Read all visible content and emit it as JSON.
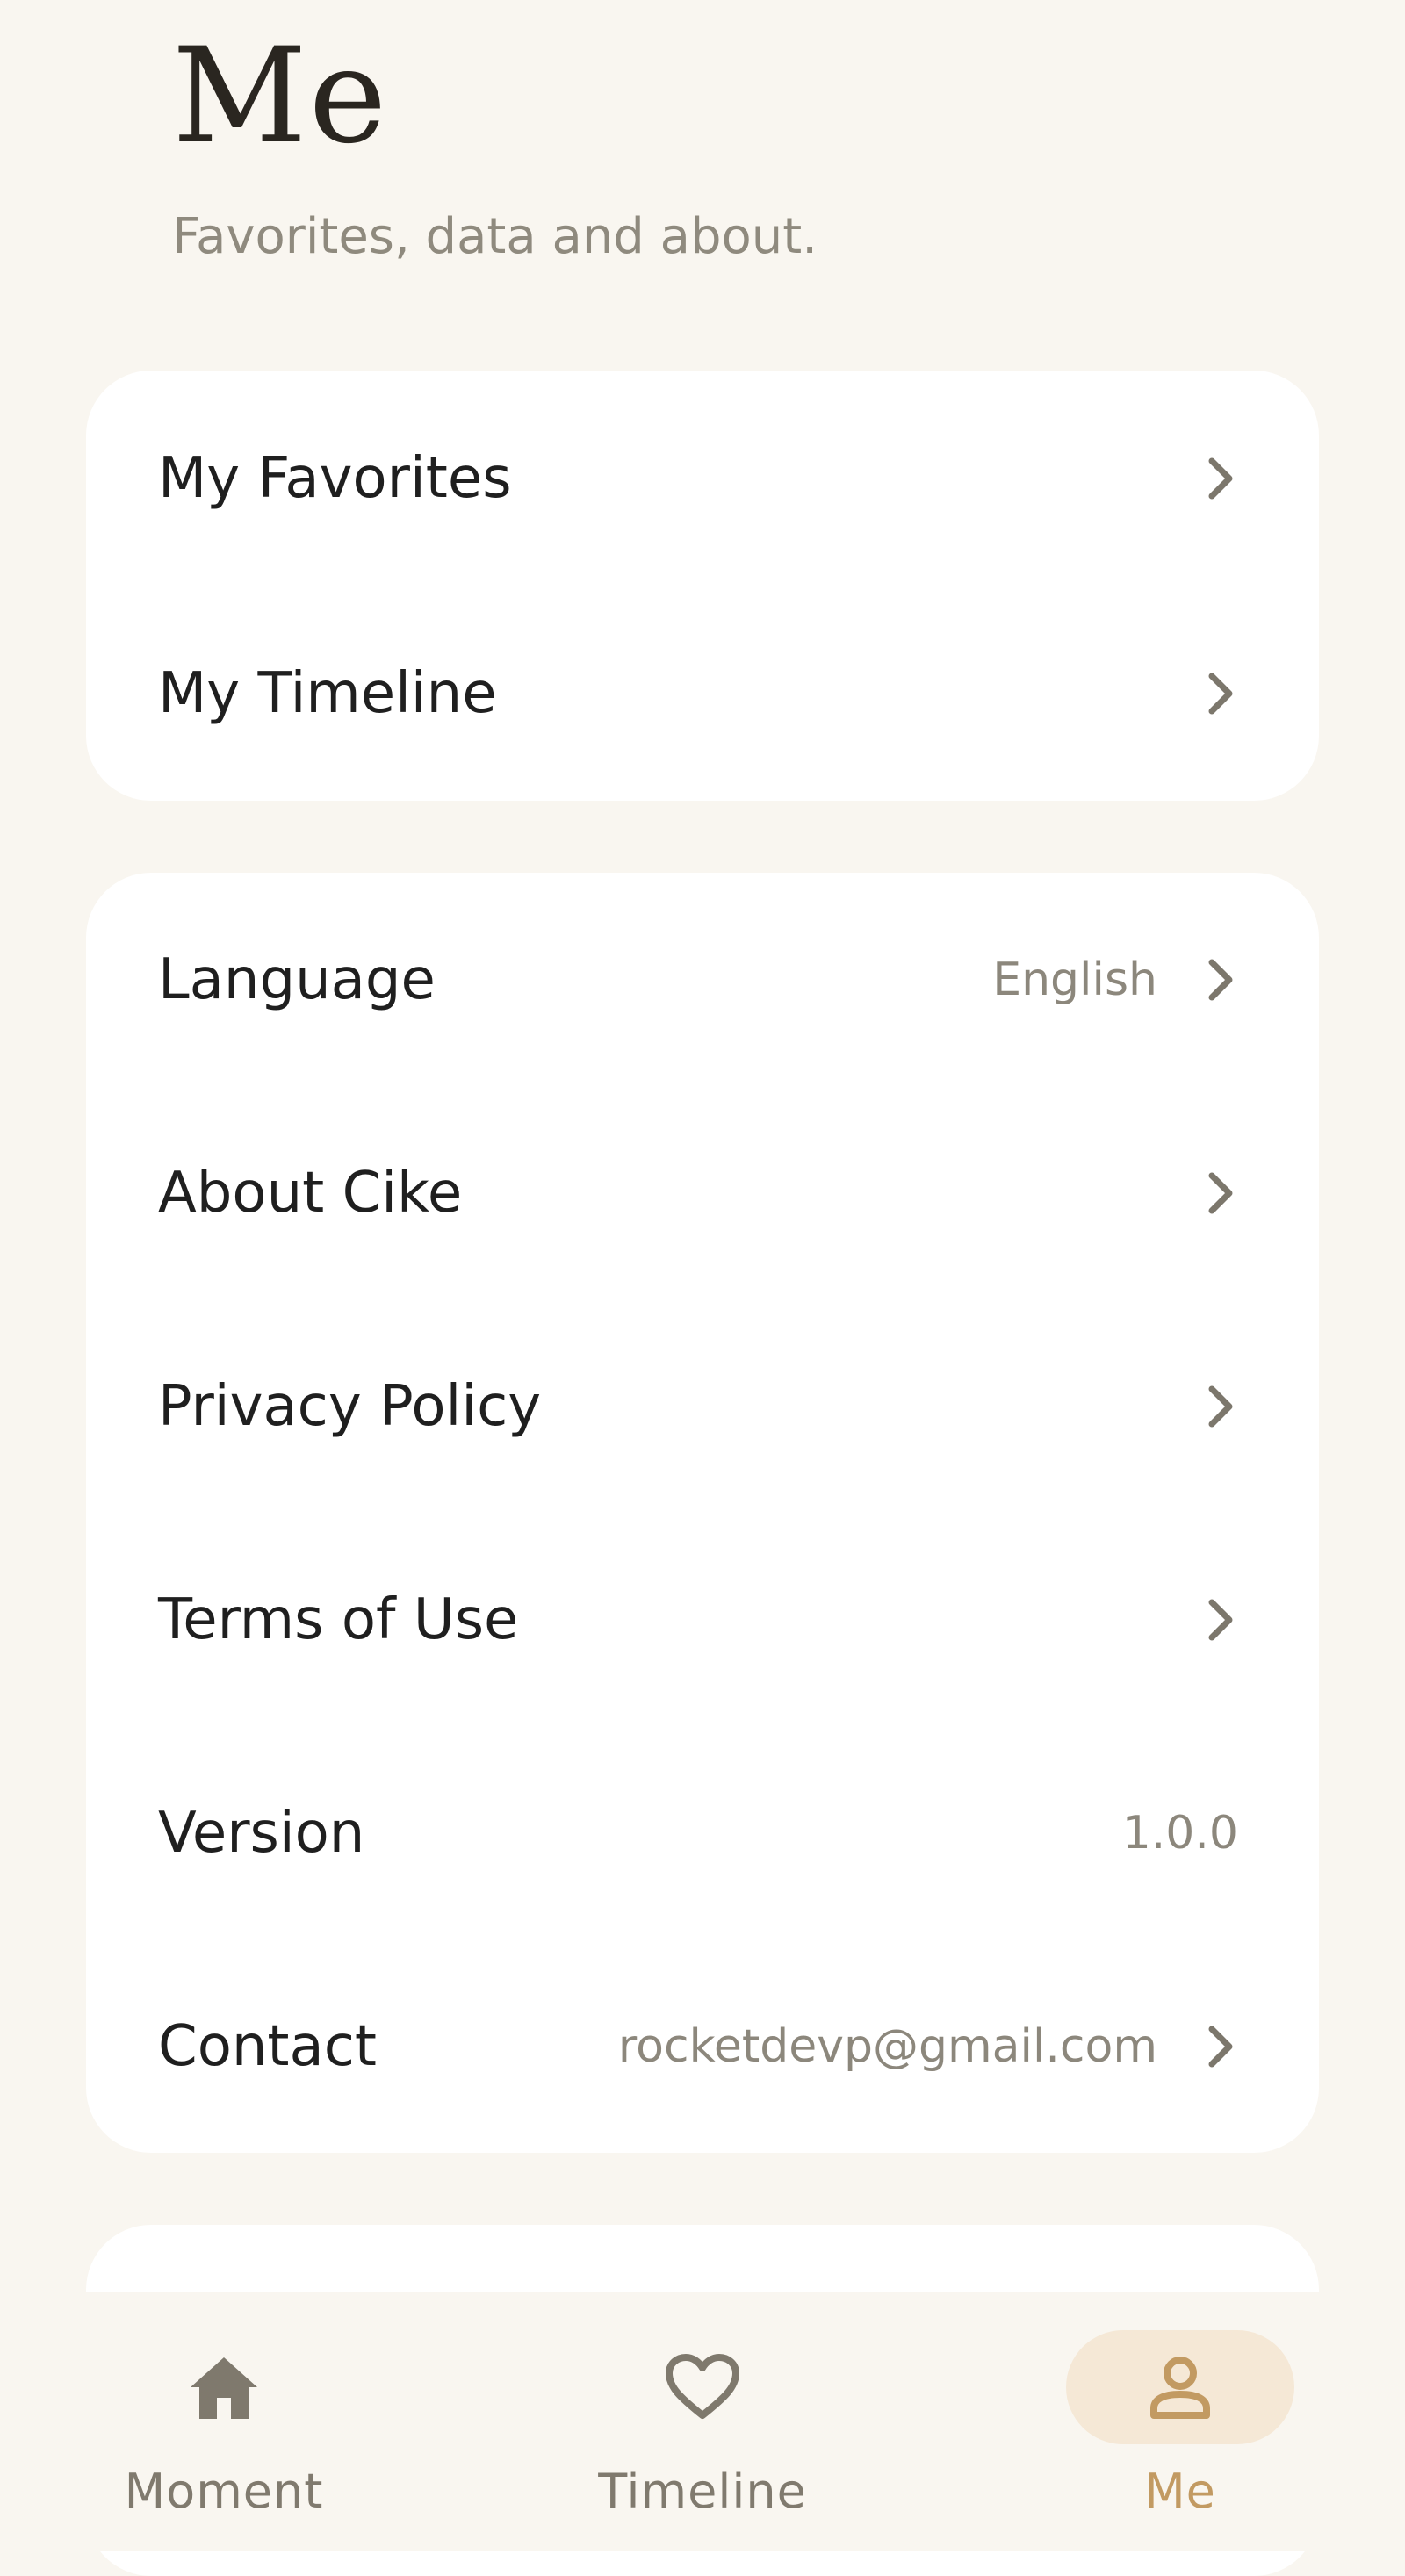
{
  "header": {
    "title": "Me",
    "subtitle": "Favorites, data and about."
  },
  "section_1": {
    "items": [
      {
        "label": "My Favorites",
        "icon": "chevron-right-icon"
      },
      {
        "label": "My Timeline",
        "icon": "chevron-right-icon"
      }
    ]
  },
  "section_2": {
    "items": [
      {
        "label": "Language",
        "value": "English",
        "icon": "chevron-right-icon"
      },
      {
        "label": "About Cike",
        "icon": "chevron-right-icon"
      },
      {
        "label": "Privacy Policy",
        "icon": "chevron-right-icon"
      },
      {
        "label": "Terms of Use",
        "icon": "chevron-right-icon"
      },
      {
        "label": "Version",
        "value": "1.0.0"
      },
      {
        "label": "Contact",
        "value": "rocketdevp@gmail.com",
        "icon": "chevron-right-icon"
      }
    ]
  },
  "tabbar": {
    "tabs": [
      {
        "label": "Moment",
        "icon": "home-icon",
        "active": false
      },
      {
        "label": "Timeline",
        "icon": "heart-icon",
        "active": false
      },
      {
        "label": "Me",
        "icon": "person-icon",
        "active": true
      }
    ]
  },
  "colors": {
    "background": "#f9f6f0",
    "card": "#ffffff",
    "accent": "#c29a62",
    "accent_pill": "#f5e8d6",
    "muted_text": "#8c877c"
  }
}
